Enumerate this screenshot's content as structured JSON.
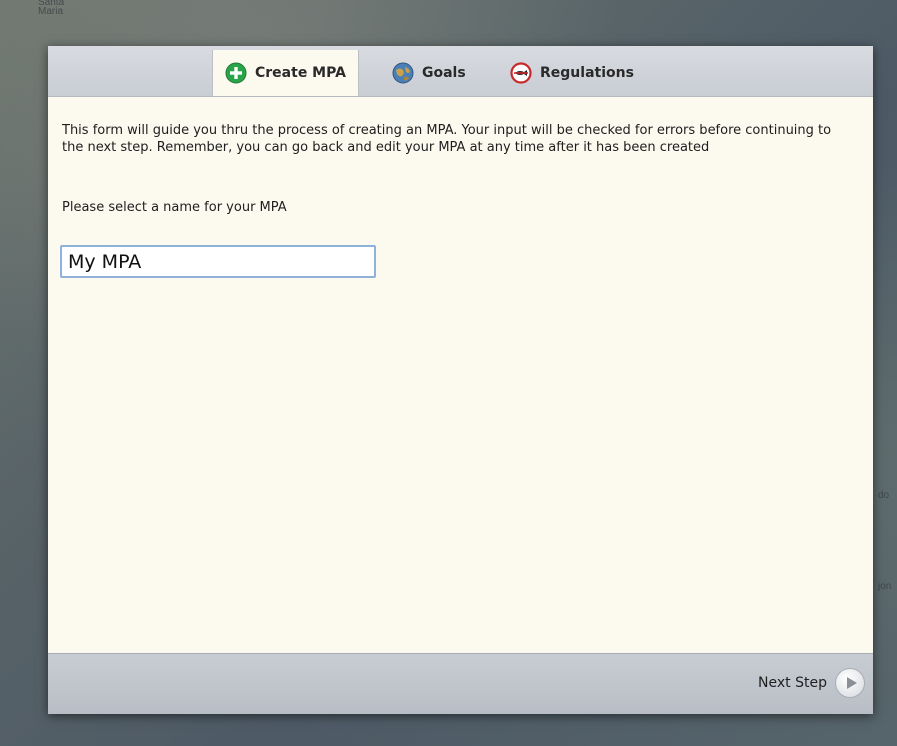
{
  "map": {
    "label_top_left": "Santa\nMaria",
    "label_right_1": "do",
    "label_right_2": "jon"
  },
  "tabs": [
    {
      "label": "Create MPA",
      "icon": "plus-circle-icon",
      "active": true
    },
    {
      "label": "Goals",
      "icon": "globe-icon",
      "active": false
    },
    {
      "label": "Regulations",
      "icon": "no-fishing-icon",
      "active": false
    }
  ],
  "form": {
    "intro_text": "This form will guide you thru the process of creating an MPA. Your input will be checked for errors before continuing to the next step. Remember, you can go back and edit your MPA at any time after it has been created",
    "name_prompt": "Please select a name for your MPA",
    "name_value": "My MPA"
  },
  "footer": {
    "next_label": "Next Step"
  },
  "colors": {
    "accent_green": "#2aa44a",
    "input_border": "#8eb2da",
    "panel_bg": "#fcf9ef"
  }
}
